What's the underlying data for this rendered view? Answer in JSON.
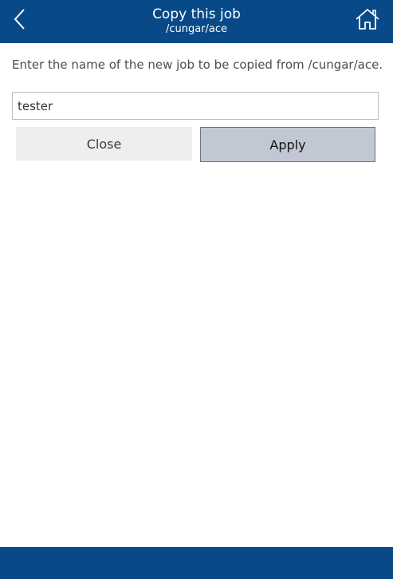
{
  "header": {
    "title": "Copy this job",
    "subtitle": "/cungar/ace",
    "back_icon": "chevron-left-icon",
    "home_icon": "home-icon"
  },
  "dialog": {
    "instruction": "Enter the name of the new job to be copied from /cungar/ace.",
    "input_value": "tester",
    "close_label": "Close",
    "apply_label": "Apply"
  },
  "colors": {
    "header_bg": "#074a87",
    "apply_bg": "#c2c7d4",
    "close_bg": "#eeeeee"
  }
}
